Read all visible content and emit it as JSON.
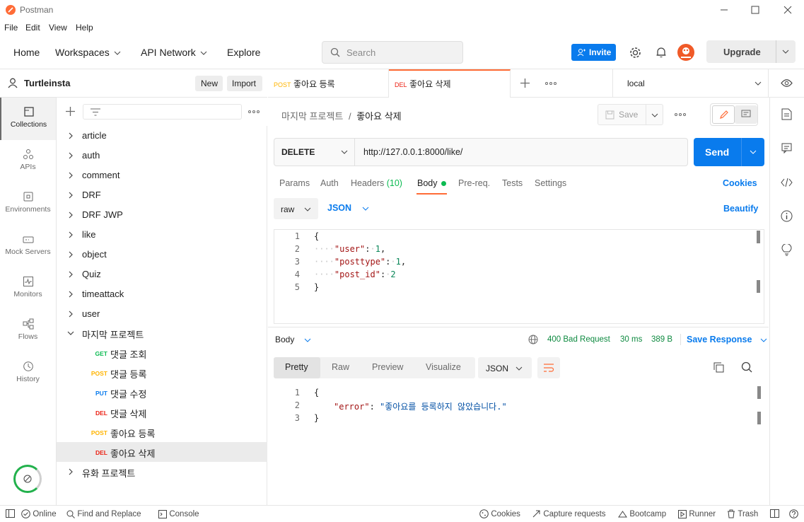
{
  "app": {
    "title": "Postman"
  },
  "menu": [
    "File",
    "Edit",
    "View",
    "Help"
  ],
  "header": {
    "nav": [
      "Home",
      "Workspaces",
      "API Network",
      "Explore"
    ],
    "search_placeholder": "Search",
    "invite_label": "Invite",
    "upgrade_label": "Upgrade"
  },
  "workspace": {
    "name": "Turtleinsta",
    "new_label": "New",
    "import_label": "Import"
  },
  "rail": [
    {
      "label": "Collections",
      "icon": "collections-icon"
    },
    {
      "label": "APIs",
      "icon": "apis-icon"
    },
    {
      "label": "Environments",
      "icon": "environments-icon"
    },
    {
      "label": "Mock Servers",
      "icon": "mock-servers-icon"
    },
    {
      "label": "Monitors",
      "icon": "monitors-icon"
    },
    {
      "label": "Flows",
      "icon": "flows-icon"
    },
    {
      "label": "History",
      "icon": "history-icon"
    }
  ],
  "collections": [
    "article",
    "auth",
    "comment",
    "DRF",
    "DRF JWP",
    "like",
    "object",
    "Quiz",
    "timeattack",
    "user"
  ],
  "open_collection": {
    "name": "마지막 프로젝트",
    "requests": [
      {
        "method": "GET",
        "name": "댓글 조회",
        "color": "#0cbb52"
      },
      {
        "method": "POST",
        "name": "댓글 등록",
        "color": "#ffb400"
      },
      {
        "method": "PUT",
        "name": "댓글 수정",
        "color": "#097bed"
      },
      {
        "method": "DEL",
        "name": "댓글 삭제",
        "color": "#eb2013"
      },
      {
        "method": "POST",
        "name": "좋아요 등록",
        "color": "#ffb400"
      },
      {
        "method": "DEL",
        "name": "좋아요 삭제",
        "color": "#eb2013"
      }
    ]
  },
  "last_collection": "유화 프로젝트",
  "tabs": [
    {
      "method": "POST",
      "name": "좋아요 등록",
      "color": "#ffb400"
    },
    {
      "method": "DEL",
      "name": "좋아요 삭제",
      "color": "#eb2013"
    }
  ],
  "environment": "local",
  "request": {
    "breadcrumb_parent": "마지막 프로젝트",
    "breadcrumb_sep": "/",
    "breadcrumb_current": "좋아요 삭제",
    "save_label": "Save",
    "method": "DELETE",
    "url": "http://127.0.0.1:8000/like/",
    "send_label": "Send",
    "subtabs": [
      {
        "label": "Params"
      },
      {
        "label": "Auth"
      },
      {
        "label": "Headers",
        "count": "(10)"
      },
      {
        "label": "Body"
      },
      {
        "label": "Pre-req."
      },
      {
        "label": "Tests"
      },
      {
        "label": "Settings"
      }
    ],
    "cookies_label": "Cookies",
    "body_mode": "raw",
    "body_format": "JSON",
    "beautify_label": "Beautify",
    "body_lines": [
      "1",
      "2",
      "3",
      "4",
      "5"
    ]
  },
  "response": {
    "label": "Body",
    "status": "400 Bad Request",
    "time": "30 ms",
    "size": "389 B",
    "save_label": "Save Response",
    "tabs": [
      "Pretty",
      "Raw",
      "Preview",
      "Visualize"
    ],
    "format": "JSON",
    "lines": [
      "1",
      "2",
      "3"
    ],
    "error_key": "\"error\"",
    "error_value": "\"좋아요를 등록하지 않았습니다.\""
  },
  "status_bar": {
    "online": "Online",
    "find_replace": "Find and Replace",
    "console": "Console",
    "cookies": "Cookies",
    "capture": "Capture requests",
    "bootcamp": "Bootcamp",
    "runner": "Runner",
    "trash": "Trash"
  }
}
